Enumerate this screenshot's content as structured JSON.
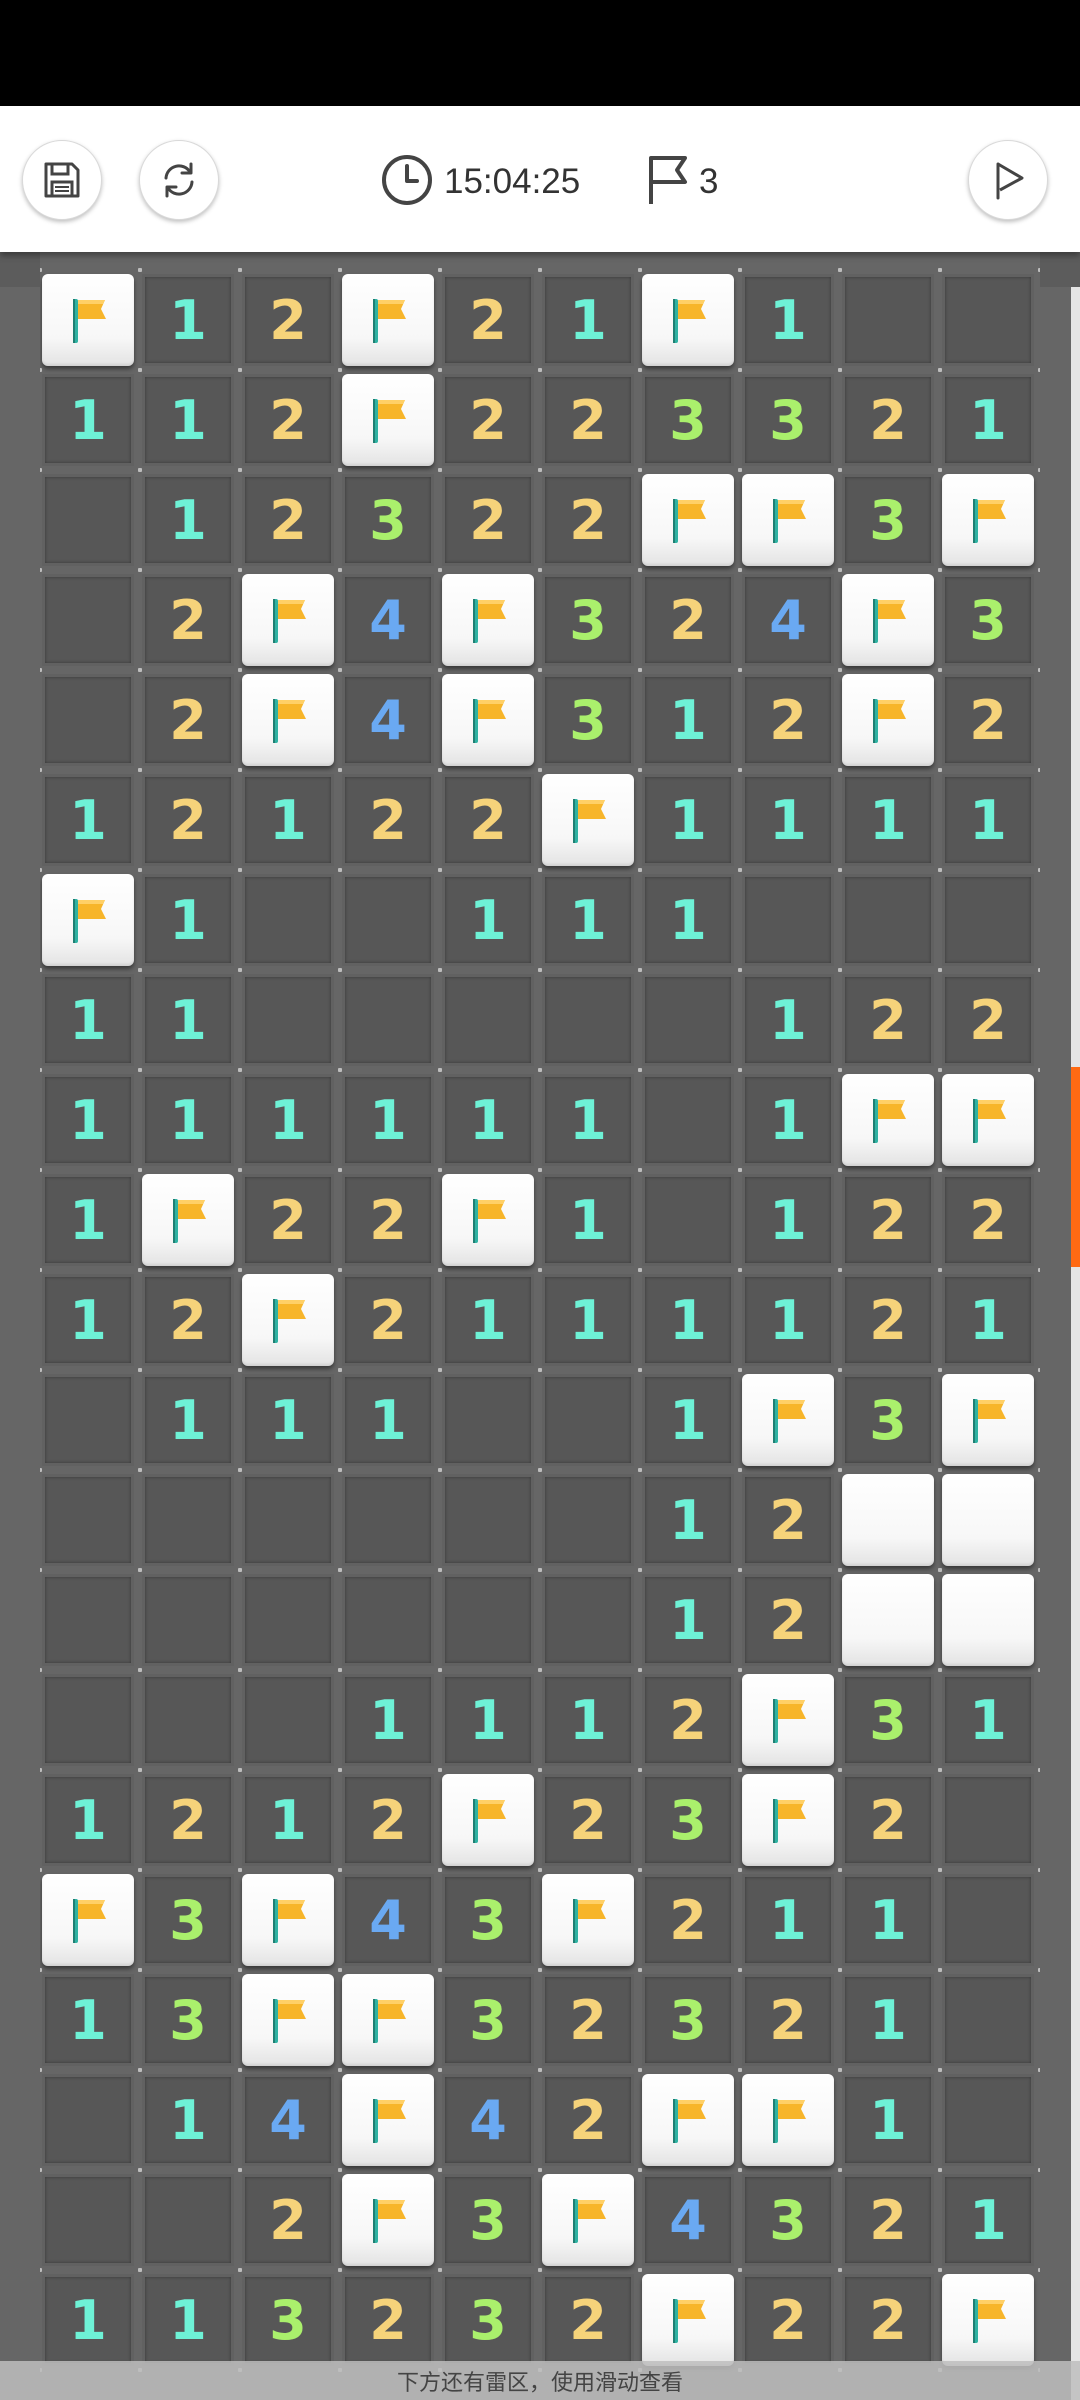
{
  "header": {
    "save_icon": "save-icon",
    "restart_icon": "restart-icon",
    "clock_icon": "clock-icon",
    "time": "15:04:25",
    "flag_icon": "flag-outline-icon",
    "flag_count": "3",
    "play_icon": "play-icon"
  },
  "colors": {
    "1": "#6ef2d6",
    "2": "#f6d37a",
    "3": "#aaf06c",
    "4": "#6aa9f2",
    "accent": "#ff6a13",
    "flag": "#f7b52a"
  },
  "board": {
    "cols": 10,
    "rows": [
      [
        "F",
        "1",
        "2",
        "F",
        "2",
        "1",
        "F",
        "1",
        "E",
        "E"
      ],
      [
        "1",
        "1",
        "2",
        "F",
        "2",
        "2",
        "3",
        "3",
        "2",
        "1"
      ],
      [
        "E",
        "1",
        "2",
        "3",
        "2",
        "2",
        "F",
        "F",
        "3",
        "F"
      ],
      [
        "E",
        "2",
        "F",
        "4",
        "F",
        "3",
        "2",
        "4",
        "F",
        "3"
      ],
      [
        "E",
        "2",
        "F",
        "4",
        "F",
        "3",
        "1",
        "2",
        "F",
        "2"
      ],
      [
        "1",
        "2",
        "1",
        "2",
        "2",
        "F",
        "1",
        "1",
        "1",
        "1"
      ],
      [
        "F",
        "1",
        "E",
        "E",
        "1",
        "1",
        "1",
        "E",
        "E",
        "E"
      ],
      [
        "1",
        "1",
        "E",
        "E",
        "E",
        "E",
        "E",
        "1",
        "2",
        "2"
      ],
      [
        "1",
        "1",
        "1",
        "1",
        "1",
        "1",
        "E",
        "1",
        "F",
        "F"
      ],
      [
        "1",
        "F",
        "2",
        "2",
        "F",
        "1",
        "E",
        "1",
        "2",
        "2"
      ],
      [
        "1",
        "2",
        "F",
        "2",
        "1",
        "1",
        "1",
        "1",
        "2",
        "1"
      ],
      [
        "E",
        "1",
        "1",
        "1",
        "E",
        "E",
        "1",
        "F",
        "3",
        "F"
      ],
      [
        "E",
        "E",
        "E",
        "E",
        "E",
        "E",
        "1",
        "2",
        "C",
        "C"
      ],
      [
        "E",
        "E",
        "E",
        "E",
        "E",
        "E",
        "1",
        "2",
        "C",
        "C"
      ],
      [
        "E",
        "E",
        "E",
        "1",
        "1",
        "1",
        "2",
        "F",
        "3",
        "1"
      ],
      [
        "1",
        "2",
        "1",
        "2",
        "F",
        "2",
        "3",
        "F",
        "2",
        "E"
      ],
      [
        "F",
        "3",
        "F",
        "4",
        "3",
        "F",
        "2",
        "1",
        "1",
        "E"
      ],
      [
        "1",
        "3",
        "F",
        "F",
        "3",
        "2",
        "3",
        "2",
        "1",
        "E"
      ],
      [
        "E",
        "1",
        "4",
        "F",
        "4",
        "2",
        "F",
        "F",
        "1",
        "E"
      ],
      [
        "E",
        "E",
        "2",
        "F",
        "3",
        "F",
        "4",
        "3",
        "2",
        "1"
      ],
      [
        "1",
        "1",
        "3",
        "2",
        "3",
        "2",
        "F",
        "2",
        "2",
        "F"
      ]
    ]
  },
  "footer": {
    "hint": "下方还有雷区，使用滑动查看"
  }
}
